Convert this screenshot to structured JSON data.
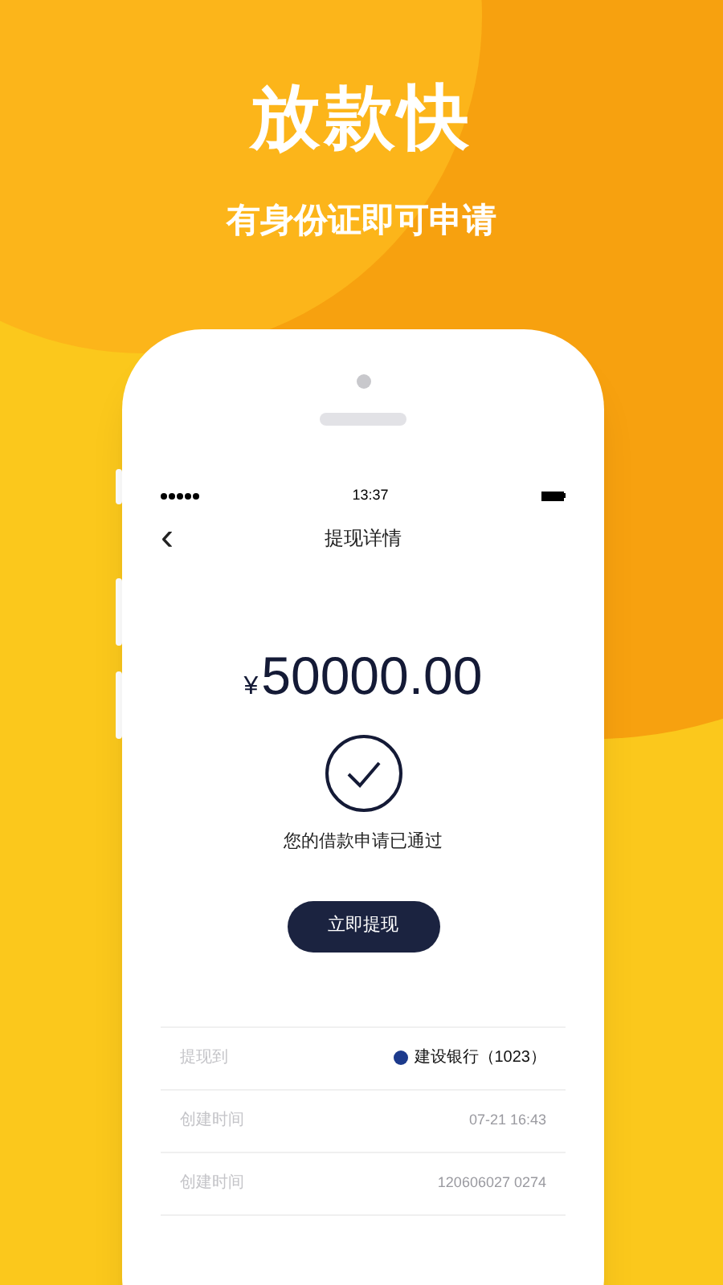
{
  "promo": {
    "headline": "放款快",
    "subline": "有身份证即可申请"
  },
  "status_bar": {
    "time": "13:37"
  },
  "nav": {
    "back": "‹",
    "title": "提现详情"
  },
  "amount": {
    "currency": "¥",
    "value": "50000.00"
  },
  "status_message": "您的借款申请已通过",
  "action_button": "立即提现",
  "details": [
    {
      "label": "提现到",
      "value": "建设银行（1023）",
      "kind": "bank"
    },
    {
      "label": "创建时间",
      "value": "07-21 16:43",
      "kind": "faded"
    },
    {
      "label": "创建时间",
      "value": "120606027 0274",
      "kind": "faded"
    }
  ]
}
